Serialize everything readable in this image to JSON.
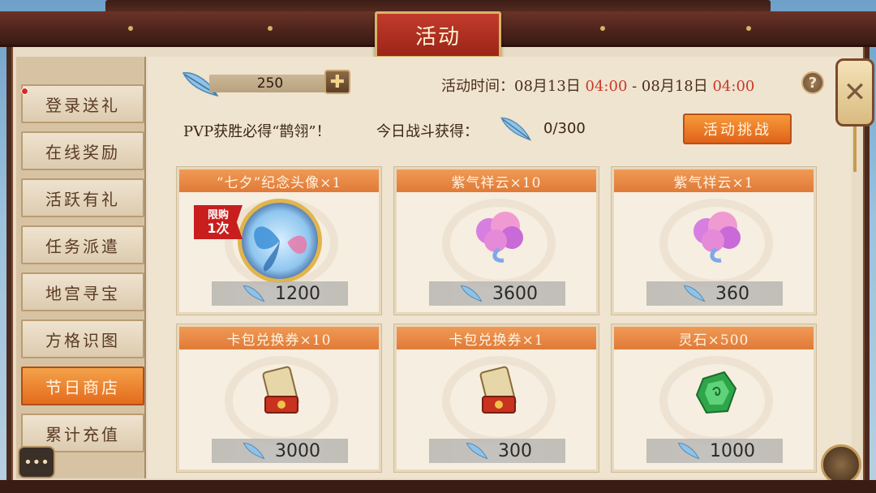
{
  "title": "活动",
  "sidebar": {
    "items": [
      {
        "label": "登录送礼",
        "active": false,
        "has_dot": true
      },
      {
        "label": "在线奖励",
        "active": false
      },
      {
        "label": "活跃有礼",
        "active": false
      },
      {
        "label": "任务派遣",
        "active": false
      },
      {
        "label": "地宫寻宝",
        "active": false
      },
      {
        "label": "方格识图",
        "active": false
      },
      {
        "label": "节日商店",
        "active": true
      },
      {
        "label": "累计充值",
        "active": false
      }
    ]
  },
  "header": {
    "currency_value": "250",
    "plus_icon": "plus-icon",
    "time_label": "活动时间：08月13日 ",
    "time_start": "04:00",
    "time_sep": " - 08月18日 ",
    "time_end": "04:00",
    "help_icon": "?"
  },
  "info": {
    "pvp_text": "PVP获胜必得“鹊翎”！",
    "today_label": "今日战斗获得：",
    "today_count": "0/300",
    "challenge_button": "活动挑战"
  },
  "shop": {
    "cards": [
      {
        "title": "“七夕”纪念头像×1",
        "price": "1200",
        "item_icon": "butterfly-avatar-icon",
        "limit_top": "限购",
        "limit_bottom": "1次"
      },
      {
        "title": "紫气祥云×10",
        "price": "3600",
        "item_icon": "purple-cloud-icon"
      },
      {
        "title": "紫气祥云×1",
        "price": "360",
        "item_icon": "purple-cloud-icon"
      },
      {
        "title": "卡包兑换券×10",
        "price": "3000",
        "item_icon": "card-pack-voucher-icon"
      },
      {
        "title": "卡包兑换券×1",
        "price": "300",
        "item_icon": "card-pack-voucher-icon"
      },
      {
        "title": "灵石×500",
        "price": "1000",
        "item_icon": "green-spirit-stone-icon"
      }
    ]
  },
  "widgets": {
    "close_icon": "✕",
    "chat_icon": "•••"
  },
  "colors": {
    "accent_orange": "#e46b1e",
    "highlight_red": "#c83a2a",
    "frame_brown": "#4a2a1e"
  }
}
